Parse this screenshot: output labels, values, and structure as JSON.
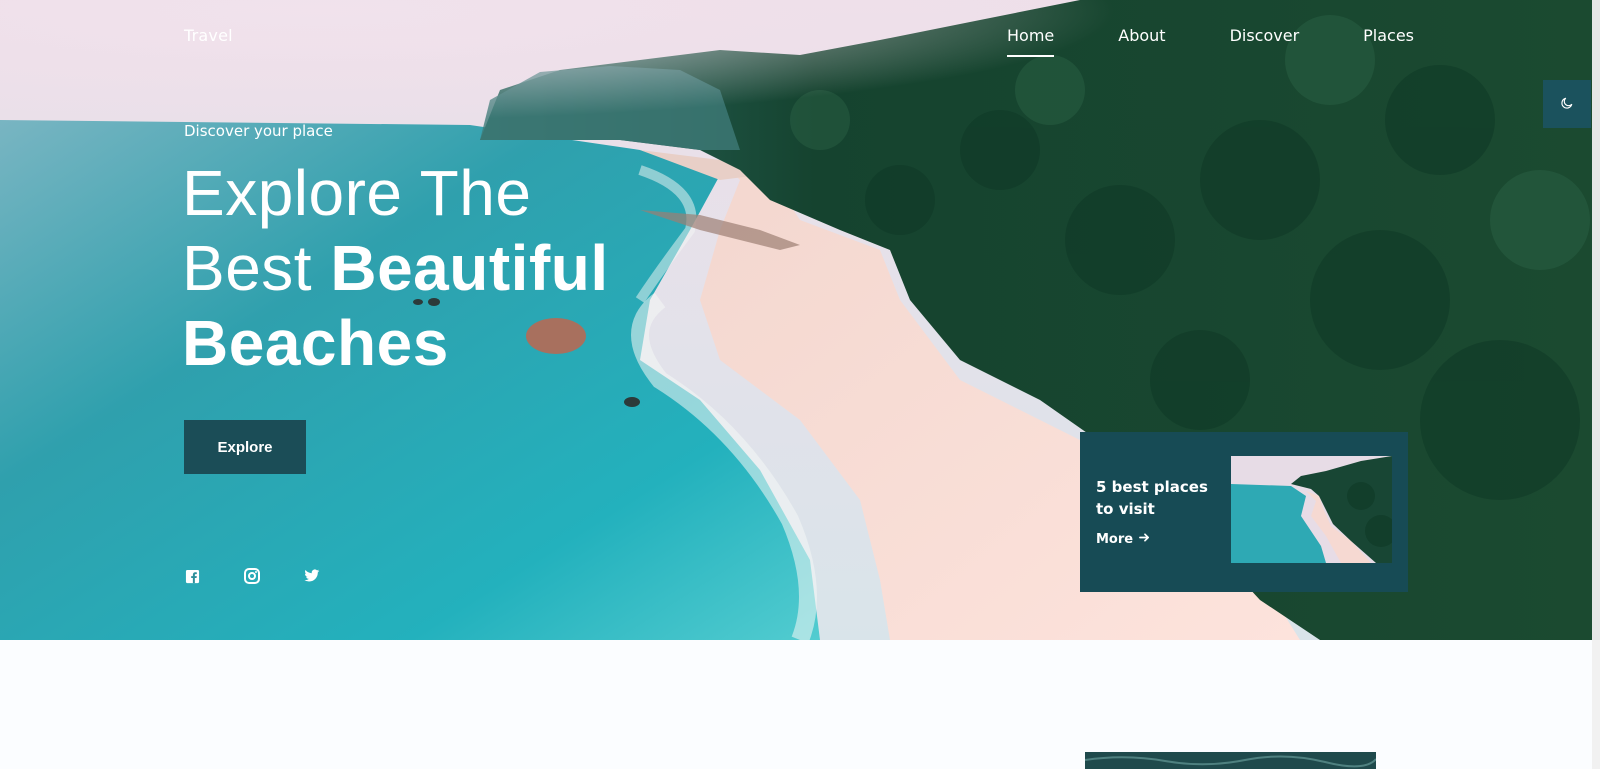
{
  "header": {
    "logo": "Travel",
    "nav": [
      {
        "label": "Home",
        "active": true
      },
      {
        "label": "About",
        "active": false
      },
      {
        "label": "Discover",
        "active": false
      },
      {
        "label": "Places",
        "active": false
      }
    ]
  },
  "theme_toggle": {
    "icon": "moon-icon"
  },
  "hero": {
    "subtitle": "Discover your place",
    "headline_line1": "Explore The",
    "headline_line2_light": "Best ",
    "headline_line2_bold": "Beautiful",
    "headline_line3_bold": "Beaches",
    "explore_label": "Explore"
  },
  "social": [
    {
      "icon": "facebook-icon"
    },
    {
      "icon": "instagram-icon"
    },
    {
      "icon": "twitter-icon"
    }
  ],
  "card": {
    "title": "5 best places to visit",
    "more_label": "More"
  },
  "colors": {
    "accent": "#1b525d",
    "card_bg": "#174b55",
    "sea": "#3fb6c0",
    "sand": "#f7d9d3",
    "forest": "#173f2c"
  }
}
